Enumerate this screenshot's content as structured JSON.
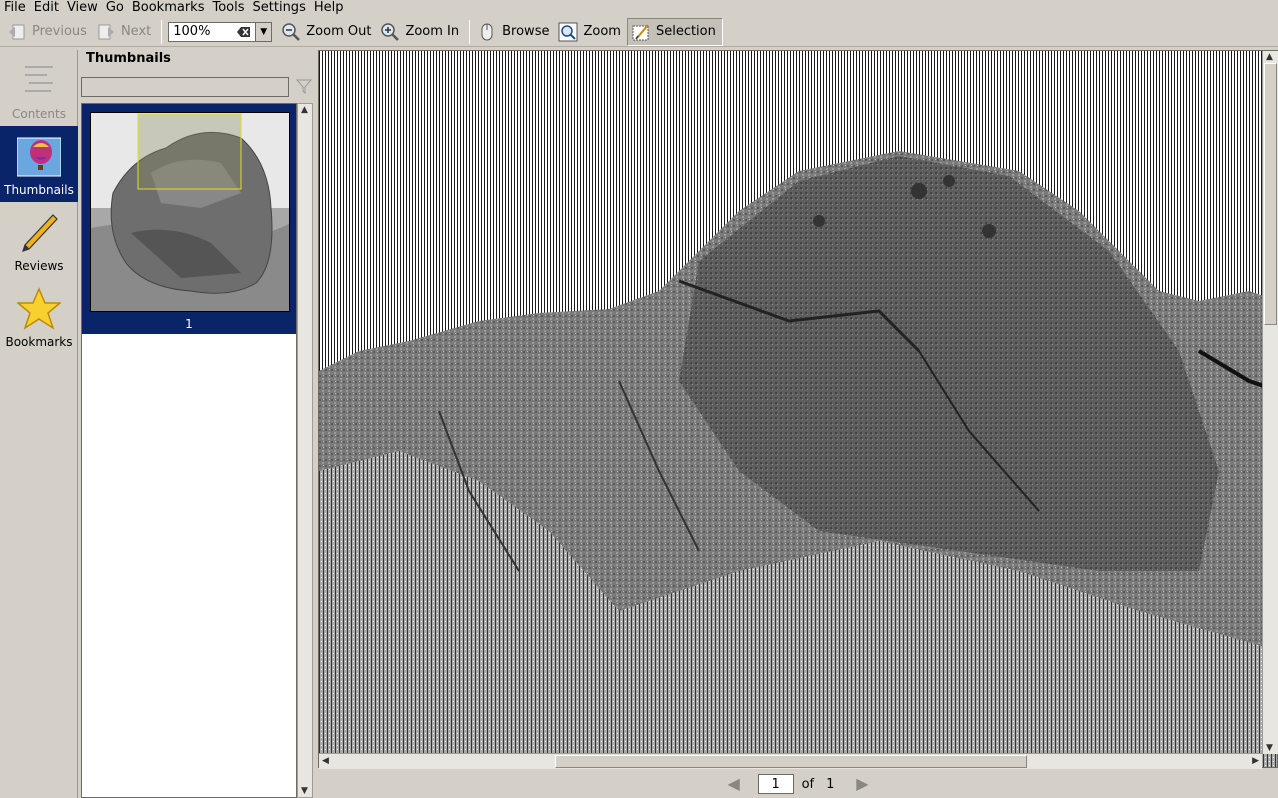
{
  "menu": {
    "file": "File",
    "edit": "Edit",
    "view": "View",
    "go": "Go",
    "bookmarks": "Bookmarks",
    "tools": "Tools",
    "settings": "Settings",
    "help": "Help"
  },
  "toolbar": {
    "previous_label": "Previous",
    "next_label": "Next",
    "zoom_value": "100%",
    "zoom_out_label": "Zoom Out",
    "zoom_in_label": "Zoom In",
    "browse_label": "Browse",
    "zoom_label": "Zoom",
    "selection_label": "Selection"
  },
  "sidebar": {
    "contents": "Contents",
    "thumbnails": "Thumbnails",
    "reviews": "Reviews",
    "bookmarks": "Bookmarks",
    "active": "Thumbnails"
  },
  "panel": {
    "title": "Thumbnails",
    "search_value": "",
    "thumb_page_label": "1"
  },
  "pagenav": {
    "current_page": "1",
    "of_label": "of",
    "total_pages": "1"
  },
  "colors": {
    "selection": "#0a246a",
    "chrome": "#d4d0c8"
  }
}
